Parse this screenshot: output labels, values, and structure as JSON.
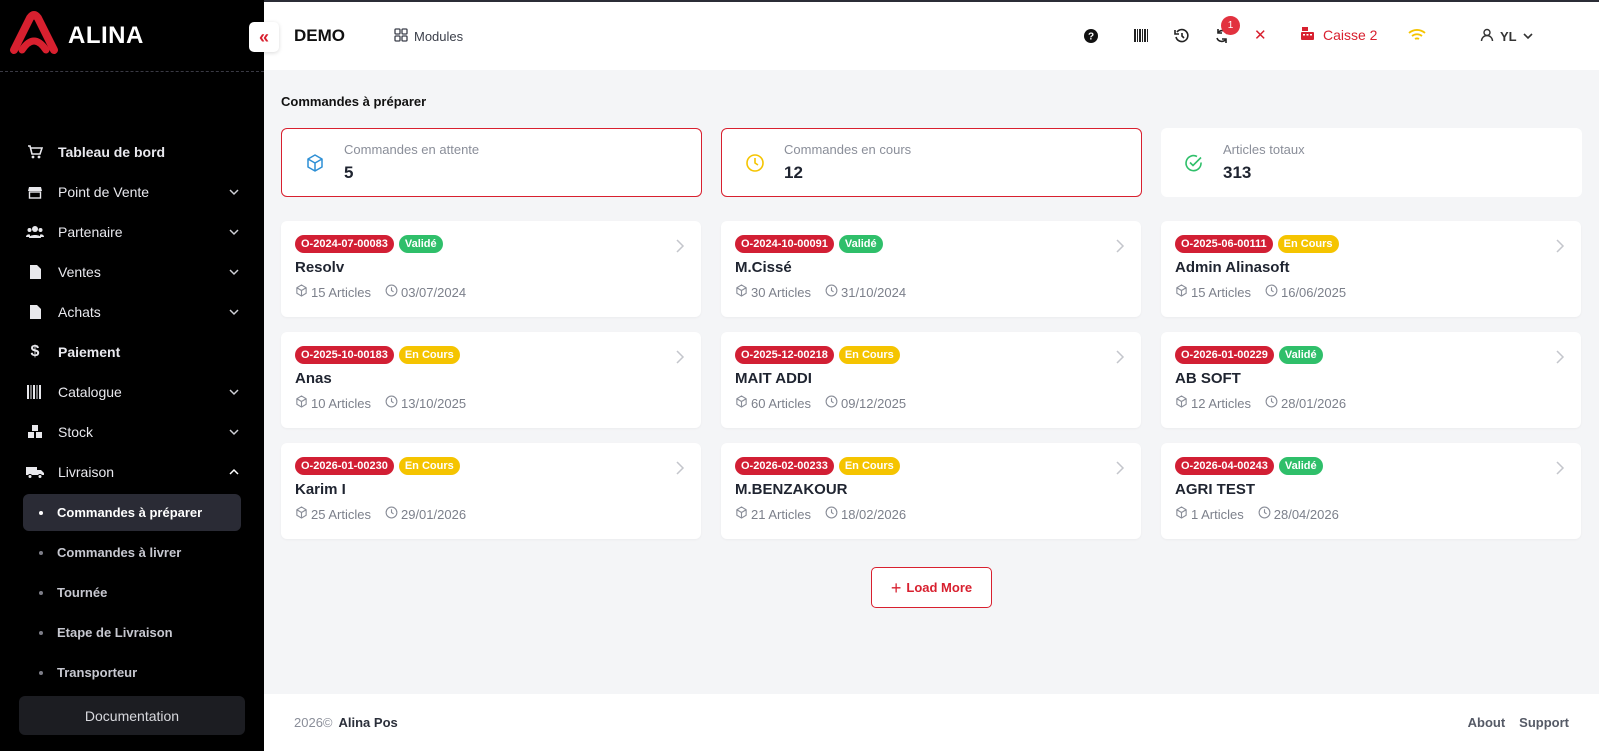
{
  "brand": {
    "name": "ALINA"
  },
  "sidebar": {
    "items": [
      {
        "label": "Tableau de bord"
      },
      {
        "label": "Point de Vente"
      },
      {
        "label": "Partenaire"
      },
      {
        "label": "Ventes"
      },
      {
        "label": "Achats"
      },
      {
        "label": "Paiement"
      },
      {
        "label": "Catalogue"
      },
      {
        "label": "Stock"
      },
      {
        "label": "Livraison"
      }
    ],
    "livraison_sub": [
      {
        "label": "Commandes à préparer"
      },
      {
        "label": "Commandes à livrer"
      },
      {
        "label": "Tournée"
      },
      {
        "label": "Etape de Livraison"
      },
      {
        "label": "Transporteur"
      }
    ],
    "documentation": "Documentation"
  },
  "header": {
    "company": "DEMO",
    "modules": "Modules",
    "sync_badge": "1",
    "caisse": "Caisse 2",
    "user": "YL",
    "collapse_glyph": "«",
    "close_glyph": "✕"
  },
  "page": {
    "title": "Commandes à préparer"
  },
  "stats": [
    {
      "label": "Commandes en attente",
      "value": "5"
    },
    {
      "label": "Commandes en cours",
      "value": "12"
    },
    {
      "label": "Articles totaux",
      "value": "313"
    }
  ],
  "orders": [
    {
      "code": "O-2024-07-00083",
      "status": "Validé",
      "name": "Resolv",
      "articles": "15 Articles",
      "date": "03/07/2024"
    },
    {
      "code": "O-2024-10-00091",
      "status": "Validé",
      "name": "M.Cissé",
      "articles": "30 Articles",
      "date": "31/10/2024"
    },
    {
      "code": "O-2025-06-00111",
      "status": "En Cours",
      "name": "Admin Alinasoft",
      "articles": "15 Articles",
      "date": "16/06/2025"
    },
    {
      "code": "O-2025-10-00183",
      "status": "En Cours",
      "name": "Anas",
      "articles": "10 Articles",
      "date": "13/10/2025"
    },
    {
      "code": "O-2025-12-00218",
      "status": "En Cours",
      "name": "MAIT ADDI",
      "articles": "60 Articles",
      "date": "09/12/2025"
    },
    {
      "code": "O-2026-01-00229",
      "status": "Validé",
      "name": "AB SOFT",
      "articles": "12 Articles",
      "date": "28/01/2026"
    },
    {
      "code": "O-2026-01-00230",
      "status": "En Cours",
      "name": "Karim I",
      "articles": "25 Articles",
      "date": "29/01/2026"
    },
    {
      "code": "O-2026-02-00233",
      "status": "En Cours",
      "name": "M.BENZAKOUR",
      "articles": "21 Articles",
      "date": "18/02/2026"
    },
    {
      "code": "O-2026-04-00243",
      "status": "Validé",
      "name": "AGRI TEST",
      "articles": "1 Articles",
      "date": "28/04/2026"
    }
  ],
  "load_more": "Load More",
  "footer": {
    "year": "2026©",
    "product": "Alina Pos",
    "about": "About",
    "support": "Support"
  },
  "colors": {
    "accent": "#d8202f",
    "valide": "#2fbf6a",
    "encours": "#f5c400"
  }
}
